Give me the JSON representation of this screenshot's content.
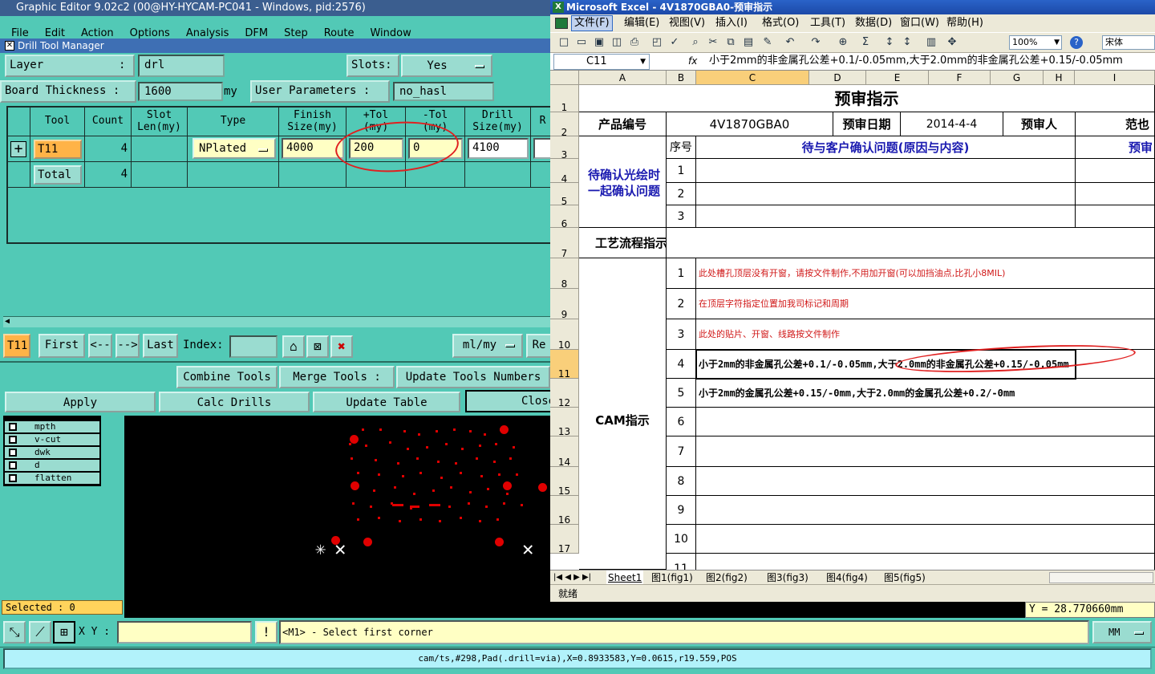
{
  "genesis": {
    "title": "Graphic Editor 9.02c2 (00@HY-HYCAM-PC041 - Windows, pid:2576)",
    "menu": [
      "File",
      "Edit",
      "Action",
      "Options",
      "Analysis",
      "DFM",
      "Step",
      "Route",
      "Window"
    ],
    "dtm": {
      "title": "Drill Tool Manager",
      "layer_label": "Layer",
      "layer_colon": ":",
      "layer_value": "drl",
      "slots_label": "Slots:",
      "slots_value": "Yes",
      "thickness_label": "Board Thickness :",
      "thickness_value": "1600",
      "thickness_unit": "my",
      "userparam_label": "User Parameters :",
      "userparam_value": "no_hasl",
      "headers": [
        "Tool",
        "Count",
        "Slot\nLen(my)",
        "Type",
        "Finish\nSize(my)",
        "+Tol\n(my)",
        "-Tol\n(my)",
        "Drill\nSize(my)",
        "R"
      ],
      "row": {
        "tool": "T11",
        "count": "4",
        "type": "NPlated",
        "finish": "4000",
        "ptol": "200",
        "mtol": "0",
        "drill": "4100"
      },
      "total": {
        "label": "Total",
        "count": "4"
      },
      "nav": {
        "current": "T11",
        "first": "First",
        "prev": "<--",
        "next": "-->",
        "last": "Last",
        "index": "Index:",
        "units": "ml/my",
        "re": "Re"
      },
      "buttons": {
        "combine": "Combine Tools",
        "merge": "Merge Tools :",
        "update_num": "Update Tools Numbers",
        "apply": "Apply",
        "calc": "Calc Drills",
        "update_table": "Update Table",
        "close": "Close"
      }
    },
    "layers": [
      "mpth",
      "v-cut",
      "dwk",
      "d",
      "flatten"
    ],
    "selected": "Selected : 0",
    "xy_label": "X Y :",
    "prompt": "<M1> - Select first corner",
    "units": "MM",
    "y_readout": "Y = 28.770660mm",
    "status": "cam/ts,#298,Pad(.drill=via),X=0.8933583,Y=0.0615,r19.559,POS"
  },
  "excel": {
    "title": "Microsoft Excel - 4V1870GBA0-预审指示",
    "menu": [
      "文件(F)",
      "编辑(E)",
      "视图(V)",
      "插入(I)",
      "格式(O)",
      "工具(T)",
      "数据(D)",
      "窗口(W)",
      "帮助(H)"
    ],
    "zoom": "100%",
    "font": "宋体",
    "cell_ref": "C11",
    "fx": "fx",
    "formula": "小于2mm的非金属孔公差+0.1/-0.05mm,大于2.0mm的非金属孔公差+0.15/-0.05mm",
    "cols": [
      "A",
      "B",
      "C",
      "D",
      "E",
      "F",
      "G",
      "H",
      "I"
    ],
    "rows": [
      "1",
      "2",
      "3",
      "4",
      "5",
      "6",
      "7",
      "8",
      "9",
      "10",
      "11",
      "12",
      "13",
      "14",
      "15",
      "16",
      "17"
    ],
    "sheet_title": "预审指示",
    "product_label": "产品编号",
    "product_value": "4V1870GBA0",
    "date_label": "预审日期",
    "date_value": "2014-4-4",
    "reviewer_label": "预审人",
    "reviewer_value": "范也",
    "seq_label": "序号",
    "confirm_header": "待与客户确认问题(原因与内容)",
    "confirm_header2": "预审",
    "pending_label": "待确认光绘时一起确认问题",
    "seqs": [
      "1",
      "2",
      "3"
    ],
    "process_label": "工艺流程指示",
    "cam_label": "CAM指示",
    "cam_nums": [
      "1",
      "2",
      "3",
      "4",
      "5",
      "6",
      "7",
      "8",
      "9",
      "10",
      "11"
    ],
    "cam_items": [
      "此处槽孔顶层没有开窗，请按文件制作,不用加开窗(可以加挡油点,比孔小8MIL)",
      "在顶层字符指定位置加我司标记和周期",
      "此处的贴片、开窗、线路按文件制作",
      "小于2mm的非金属孔公差+0.1/-0.05mm,大于2.0mm的非金属孔公差+0.15/-0.05mm",
      "小于2mm的金属孔公差+0.15/-0mm,大于2.0mm的金属孔公差+0.2/-0mm"
    ],
    "tabs": [
      "Sheet1",
      "图1(fig1)",
      "图2(fig2)",
      "图3(fig3)",
      "图4(fig4)",
      "图5(fig5)"
    ],
    "status": "就绪"
  }
}
